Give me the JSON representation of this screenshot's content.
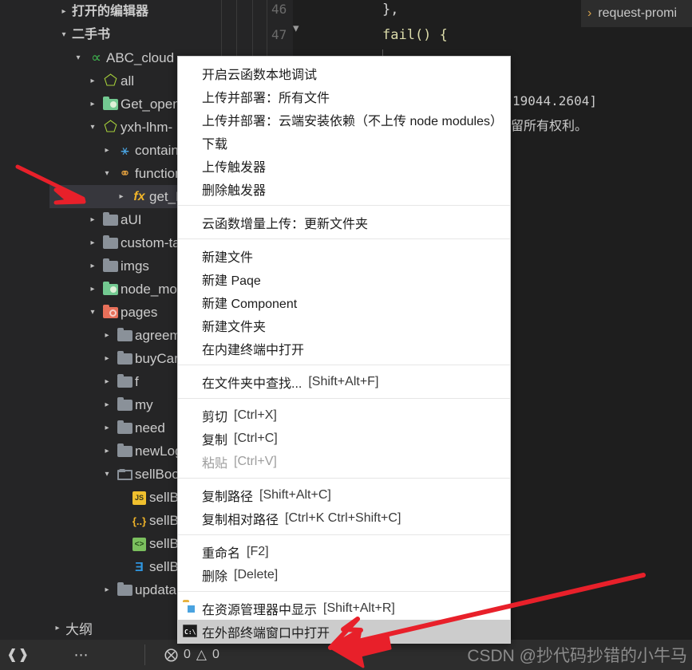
{
  "app": {
    "theme_bg": "#1e1e1e",
    "sidebar_bg": "#252526",
    "selection_bg": "#37373d",
    "accent_red": "#e8202a"
  },
  "sidebar": {
    "sections": [
      {
        "label": "打开的编辑器",
        "expanded": false
      },
      {
        "label": "二手书",
        "expanded": true
      }
    ],
    "tree": [
      {
        "label": "ABC_cloud",
        "icon": "cloud-function-icon",
        "twisty": "▾",
        "indent": 1,
        "selected": false
      },
      {
        "label": "all",
        "icon": "hexagon-icon",
        "twisty": "▸",
        "indent": 2,
        "selected": false
      },
      {
        "label": "Get_open",
        "icon": "folder-green-icon",
        "twisty": "▸",
        "indent": 2,
        "selected": false
      },
      {
        "label": "yxh-lhm-",
        "icon": "hexagon-icon",
        "twisty": "▾",
        "indent": 2,
        "selected": false
      },
      {
        "label": "contain",
        "icon": "bowler-hat-icon",
        "twisty": "▸",
        "indent": 3,
        "selected": false
      },
      {
        "label": "function",
        "icon": "function-folder-icon",
        "twisty": "▾",
        "indent": 3,
        "selected": false
      },
      {
        "label": "get_Bo",
        "icon": "fx-icon",
        "twisty": "▸",
        "indent": 4,
        "selected": true
      },
      {
        "label": "aUI",
        "icon": "folder-grey-icon",
        "twisty": "▸",
        "indent": 2,
        "selected": false
      },
      {
        "label": "custom-ta",
        "icon": "folder-grey-icon",
        "twisty": "▸",
        "indent": 2,
        "selected": false
      },
      {
        "label": "imgs",
        "icon": "folder-grey-icon",
        "twisty": "▸",
        "indent": 2,
        "selected": false
      },
      {
        "label": "node_mod",
        "icon": "folder-green-icon",
        "twisty": "▸",
        "indent": 2,
        "selected": false
      },
      {
        "label": "pages",
        "icon": "folder-red-icon",
        "twisty": "▾",
        "indent": 2,
        "selected": false
      },
      {
        "label": "agreeme",
        "icon": "folder-grey-icon",
        "twisty": "▸",
        "indent": 3,
        "selected": false
      },
      {
        "label": "buyCar",
        "icon": "folder-grey-icon",
        "twisty": "▸",
        "indent": 3,
        "selected": false
      },
      {
        "label": "f",
        "icon": "folder-grey-icon",
        "twisty": "▸",
        "indent": 3,
        "selected": false
      },
      {
        "label": "my",
        "icon": "folder-grey-icon",
        "twisty": "▸",
        "indent": 3,
        "selected": false
      },
      {
        "label": "need",
        "icon": "folder-grey-icon",
        "twisty": "▸",
        "indent": 3,
        "selected": false
      },
      {
        "label": "newLogin",
        "icon": "folder-grey-icon",
        "twisty": "▸",
        "indent": 3,
        "selected": false
      },
      {
        "label": "sellBook",
        "icon": "folder-open-grey-icon",
        "twisty": "▾",
        "indent": 3,
        "selected": false
      },
      {
        "label": "sellBook",
        "icon": "js-file-icon",
        "twisty": "",
        "indent": 4,
        "selected": false
      },
      {
        "label": "sellBook",
        "icon": "json-file-icon",
        "twisty": "",
        "indent": 4,
        "selected": false
      },
      {
        "label": "sellBook",
        "icon": "wxml-file-icon",
        "twisty": "",
        "indent": 4,
        "selected": false
      },
      {
        "label": "sellBook",
        "icon": "wxss-file-icon",
        "twisty": "",
        "indent": 4,
        "selected": false
      },
      {
        "label": "updata",
        "icon": "folder-grey-icon",
        "twisty": "▸",
        "indent": 3,
        "selected": false
      }
    ],
    "outline": {
      "label": "大纲",
      "twisty": "▸"
    }
  },
  "statusbar": {
    "remote_icon": "remote-window-icon",
    "more_icon": "ellipsis-icon",
    "errors": "0",
    "warnings": "0",
    "error_icon": "error-circle-icon",
    "warning_icon": "warning-triangle-icon"
  },
  "editor": {
    "lines": [
      {
        "number": "46",
        "code": "},"
      },
      {
        "number": "47",
        "code": "fail() {"
      }
    ],
    "fold_icon": "chevron-down-icon"
  },
  "terminal": {
    "tab_label": "request-promi",
    "tab_chevron": "›",
    "lines": [
      "19044.2604]",
      "留所有权利。"
    ]
  },
  "context_menu": {
    "groups": [
      {
        "items": [
          {
            "label": "开启云函数本地调试",
            "key": "",
            "disabled": false,
            "highlight": false,
            "icon": ""
          },
          {
            "label": "上传并部署：所有文件",
            "key": "",
            "disabled": false,
            "highlight": false,
            "icon": ""
          },
          {
            "label": "上传并部署：云端安装依赖（不上传 node modules）",
            "key": "",
            "disabled": false,
            "highlight": false,
            "icon": ""
          },
          {
            "label": "下载",
            "key": "",
            "disabled": false,
            "highlight": false,
            "icon": ""
          },
          {
            "label": "上传触发器",
            "key": "",
            "disabled": false,
            "highlight": false,
            "icon": ""
          },
          {
            "label": "删除触发器",
            "key": "",
            "disabled": false,
            "highlight": false,
            "icon": ""
          }
        ]
      },
      {
        "items": [
          {
            "label": "云函数增量上传：更新文件夹",
            "key": "",
            "disabled": false,
            "highlight": false,
            "icon": ""
          }
        ]
      },
      {
        "items": [
          {
            "label": "新建文件",
            "key": "",
            "disabled": false,
            "highlight": false,
            "icon": ""
          },
          {
            "label": "新建 Paqe",
            "key": "",
            "disabled": false,
            "highlight": false,
            "icon": ""
          },
          {
            "label": "新建 Component",
            "key": "",
            "disabled": false,
            "highlight": false,
            "icon": ""
          },
          {
            "label": "新建文件夹",
            "key": "",
            "disabled": false,
            "highlight": false,
            "icon": ""
          },
          {
            "label": "在内建终端中打开",
            "key": "",
            "disabled": false,
            "highlight": false,
            "icon": ""
          }
        ]
      },
      {
        "items": [
          {
            "label": "在文件夹中查找...",
            "key": "[Shift+Alt+F]",
            "disabled": false,
            "highlight": false,
            "icon": ""
          }
        ]
      },
      {
        "items": [
          {
            "label": "剪切",
            "key": "[Ctrl+X]",
            "disabled": false,
            "highlight": false,
            "icon": ""
          },
          {
            "label": "复制",
            "key": "[Ctrl+C]",
            "disabled": false,
            "highlight": false,
            "icon": ""
          },
          {
            "label": "粘贴",
            "key": "[Ctrl+V]",
            "disabled": true,
            "highlight": false,
            "icon": ""
          }
        ]
      },
      {
        "items": [
          {
            "label": "复制路径",
            "key": "[Shift+Alt+C]",
            "disabled": false,
            "highlight": false,
            "icon": ""
          },
          {
            "label": "复制相对路径",
            "key": "[Ctrl+K Ctrl+Shift+C]",
            "disabled": false,
            "highlight": false,
            "icon": ""
          }
        ]
      },
      {
        "items": [
          {
            "label": "重命名",
            "key": "[F2]",
            "disabled": false,
            "highlight": false,
            "icon": ""
          },
          {
            "label": "删除",
            "key": "[Delete]",
            "disabled": false,
            "highlight": false,
            "icon": ""
          }
        ]
      },
      {
        "items": [
          {
            "label": "在资源管理器中显示",
            "key": "[Shift+Alt+R]",
            "disabled": false,
            "highlight": false,
            "icon": "explorer-icon"
          },
          {
            "label": "在外部终端窗口中打开",
            "key": "",
            "disabled": false,
            "highlight": true,
            "icon": "cmd-icon"
          }
        ]
      }
    ]
  },
  "annotations": {
    "arrows": [
      {
        "name": "arrow-pointing-to-get-book-node"
      },
      {
        "name": "arrow-pointing-to-open-in-external-terminal"
      }
    ]
  },
  "watermark": {
    "text": "CSDN @抄代码抄错的小牛马"
  }
}
